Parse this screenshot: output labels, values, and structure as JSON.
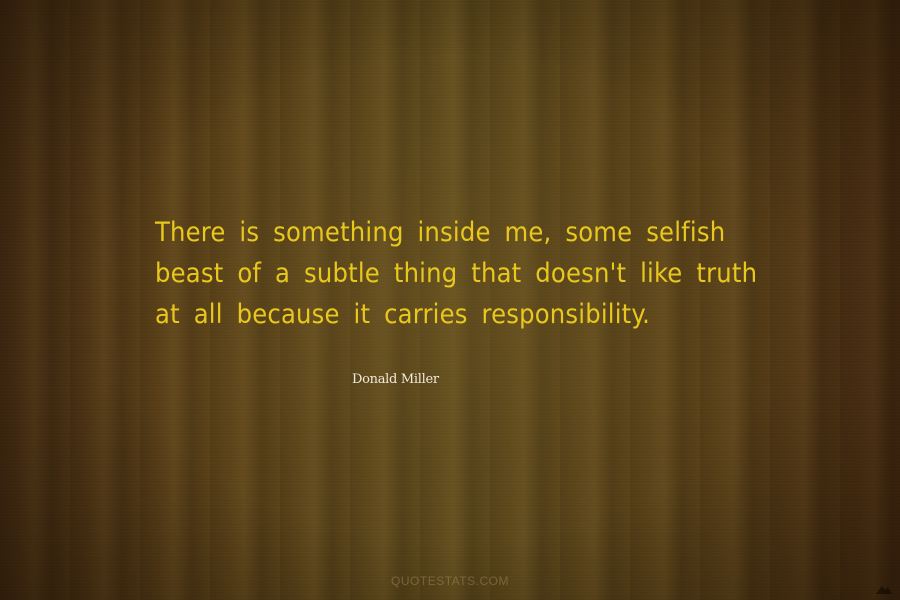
{
  "quote": {
    "lines": [
      "There is something inside me, some selfish",
      "beast of a subtle thing that doesn't like truth",
      "at all because it carries responsibility."
    ]
  },
  "author": "Donald Miller",
  "watermark": "QUOTESTATS.COM",
  "colors": {
    "quote_text": "#e8c81c",
    "author_text": "#f0ead8",
    "background": "#5a4018"
  }
}
